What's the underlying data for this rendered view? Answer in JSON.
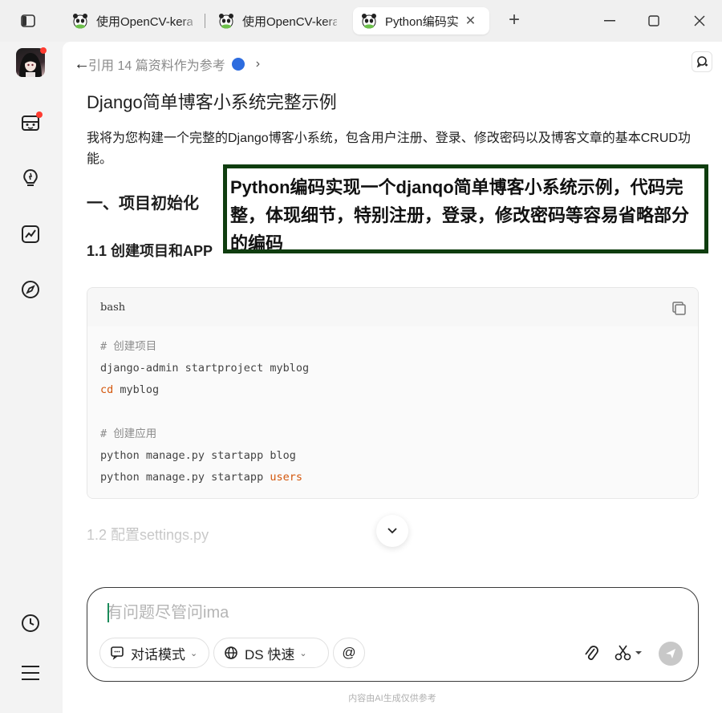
{
  "tabs": [
    {
      "title": "使用OpenCV-keras",
      "active": false
    },
    {
      "title": "使用OpenCV-keras",
      "active": false
    },
    {
      "title": "Python编码实",
      "active": true
    }
  ],
  "window": {
    "new_tab": "+"
  },
  "reference": {
    "text": "引用 14 篇资料作为参考"
  },
  "article": {
    "title": "Django简单博客小系统完整示例",
    "intro": "我将为您构建一个完整的Django博客小系统，包含用户注册、登录、修改密码以及博客文章的基本CRUD功能。",
    "section1": "一、项目初始化",
    "section1_1": "1.1 创建项目和APP",
    "section1_2": "1.2 配置settings.py"
  },
  "code": {
    "language": "bash",
    "lines": [
      {
        "parts": [
          {
            "t": "# 创建项目",
            "cls": "c-comment"
          }
        ]
      },
      {
        "parts": [
          {
            "t": "django-admin startproject myblog",
            "cls": ""
          }
        ]
      },
      {
        "parts": [
          {
            "t": "cd",
            "cls": "c-kw"
          },
          {
            "t": " myblog",
            "cls": ""
          }
        ]
      },
      {
        "parts": [
          {
            "t": "",
            "cls": ""
          }
        ]
      },
      {
        "parts": [
          {
            "t": "# 创建应用",
            "cls": "c-comment"
          }
        ]
      },
      {
        "parts": [
          {
            "t": "python manage.py startapp blog",
            "cls": ""
          }
        ]
      },
      {
        "parts": [
          {
            "t": "python manage.py startapp ",
            "cls": ""
          },
          {
            "t": "users",
            "cls": "c-kw"
          }
        ]
      }
    ]
  },
  "composer": {
    "placeholder": "有问题尽管问ima",
    "mode_label": "对话模式",
    "model_label": "DS 快速",
    "at_label": "@"
  },
  "footer_note": "内容由AI生成仅供参考",
  "annotation": "Python编码实现一个djanqo简单博客小系统示例，代码完整，体现细节，特别注册，登录，修改密码等容易省略部分的编码"
}
